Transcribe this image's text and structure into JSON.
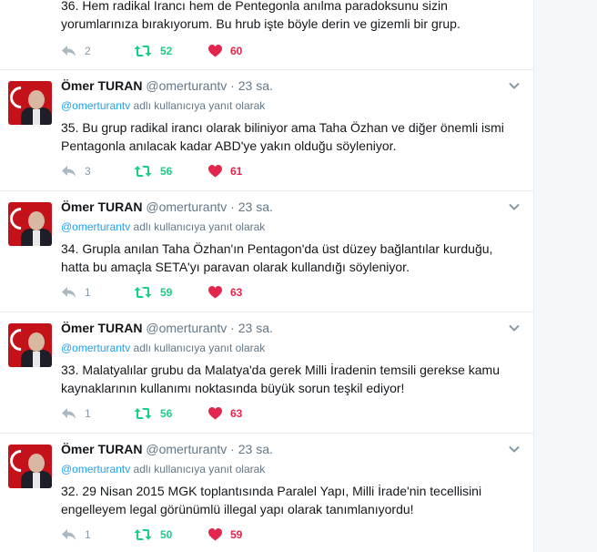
{
  "tweets": [
    {
      "partial": true,
      "text_line1": "36. Hem radikal İrancı hem de Pentegonla anılma paradoksunu sizin",
      "text_line2": "yorumlarınıza bırakıyorum. Bu hrub işte böyle derin ve gizemli bir grup.",
      "replies": "2",
      "retweets": "52",
      "likes": "60"
    },
    {
      "name": "Ömer TURAN",
      "handle": "@omerturantv",
      "time": "23 sa.",
      "reply_mention": "@omerturantv",
      "reply_suffix": " adlı kullanıcıya yanıt olarak",
      "text_line1": "35. Bu grup radikal irancı olarak biliniyor ama Taha Özhan ve diğer önemli ismi",
      "text_line2": "Pentagonla anılacak kadar ABD'ye yakın olduğu söyleniyor.",
      "replies": "3",
      "retweets": "56",
      "likes": "61"
    },
    {
      "name": "Ömer TURAN",
      "handle": "@omerturantv",
      "time": "23 sa.",
      "reply_mention": "@omerturantv",
      "reply_suffix": " adlı kullanıcıya yanıt olarak",
      "text_line1": "34. Grupla anılan Taha Özhan'ın Pentagon'da üst düzey bağlantılar kurduğu,",
      "text_line2": "hatta bu amaçla SETA'yı paravan olarak kullandığı söyleniyor.",
      "replies": "1",
      "retweets": "59",
      "likes": "63"
    },
    {
      "name": "Ömer TURAN",
      "handle": "@omerturantv",
      "time": "23 sa.",
      "reply_mention": "@omerturantv",
      "reply_suffix": " adlı kullanıcıya yanıt olarak",
      "text_line1": "33. Malatyalılar grubu da Malatya'da gerek Milli İradenin temsili gerekse kamu",
      "text_line2": "kaynaklarının kullanımı noktasında büyük sorun teşkil ediyor!",
      "replies": "1",
      "retweets": "56",
      "likes": "63"
    },
    {
      "name": "Ömer TURAN",
      "handle": "@omerturantv",
      "time": "23 sa.",
      "reply_mention": "@omerturantv",
      "reply_suffix": " adlı kullanıcıya yanıt olarak",
      "text_line1": "32. 29 Nisan 2015 MGK toplantısında Paralel Yapı, Milli İrade'nin tecellisini",
      "text_line2": "engelleyem legal görünümlü illegal yapı olarak tanımlanıyordu!",
      "replies": "1",
      "retweets": "50",
      "likes": "59"
    }
  ],
  "separator": " · ",
  "colors": {
    "retweet": "#19cf86",
    "like": "#e2264d",
    "link": "#1da1f2",
    "muted": "#657786"
  },
  "icons": [
    "reply-icon",
    "retweet-icon",
    "heart-icon",
    "chevron-down-icon"
  ]
}
